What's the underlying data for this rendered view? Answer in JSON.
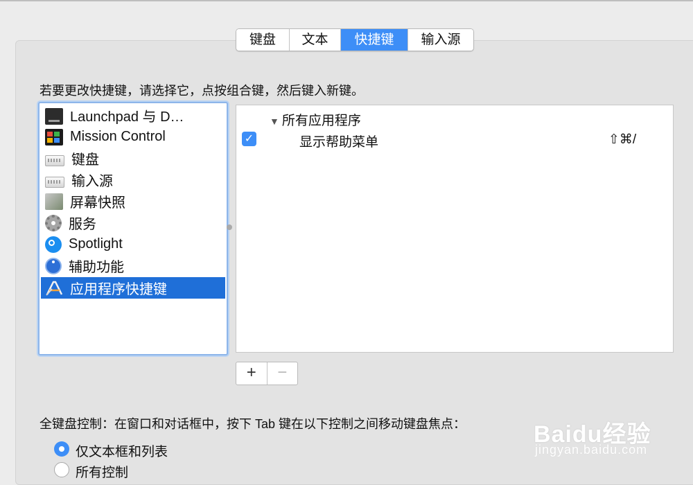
{
  "tabs": [
    {
      "label": "键盘"
    },
    {
      "label": "文本"
    },
    {
      "label": "快捷键",
      "active": true
    },
    {
      "label": "输入源"
    }
  ],
  "instruction": "若要更改快捷键，请选择它，点按组合键，然后键入新键。",
  "categories": [
    {
      "label": "Launchpad 与 D…",
      "icon": "launchpad-icon"
    },
    {
      "label": "Mission Control",
      "icon": "mission-control-icon"
    },
    {
      "label": "键盘",
      "icon": "keyboard-icon"
    },
    {
      "label": "输入源",
      "icon": "keyboard-icon"
    },
    {
      "label": "屏幕快照",
      "icon": "screenshot-icon"
    },
    {
      "label": "服务",
      "icon": "gear-icon"
    },
    {
      "label": "Spotlight",
      "icon": "spotlight-icon"
    },
    {
      "label": "辅助功能",
      "icon": "accessibility-icon"
    },
    {
      "label": "应用程序快捷键",
      "icon": "app-shortcuts-icon",
      "selected": true
    }
  ],
  "shortcuts": {
    "group_label": "所有应用程序",
    "items": [
      {
        "enabled": true,
        "name": "显示帮助菜单",
        "keys": "⇧⌘/"
      }
    ]
  },
  "buttons": {
    "add": "+",
    "remove": "−"
  },
  "keyboard_control": {
    "label": "全键盘控制：在窗口和对话框中，按下 Tab 键在以下控制之间移动键盘焦点：",
    "options": [
      {
        "label": "仅文本框和列表",
        "selected": true
      },
      {
        "label": "所有控制",
        "selected": false
      }
    ]
  },
  "watermark": {
    "logo": "Baidu经验",
    "url": "jingyan.baidu.com"
  },
  "colors": {
    "accent": "#3d8ef7",
    "selection": "#1f6fd8"
  }
}
